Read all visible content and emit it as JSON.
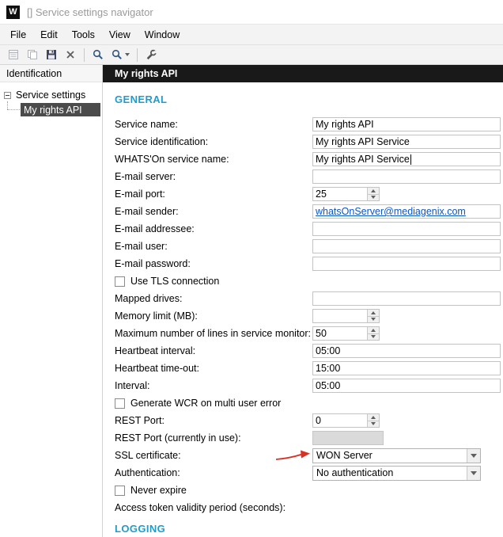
{
  "window": {
    "title": "[] Service settings navigator",
    "logo_letter": "W"
  },
  "menu": {
    "items": [
      {
        "label": "File"
      },
      {
        "label": "Edit"
      },
      {
        "label": "Tools"
      },
      {
        "label": "View"
      },
      {
        "label": "Window"
      }
    ]
  },
  "toolbar": {
    "buttons": [
      {
        "icon": "report-icon",
        "enabled": false
      },
      {
        "icon": "copy-icon",
        "enabled": false
      },
      {
        "icon": "save-icon",
        "enabled": true
      },
      {
        "icon": "delete-icon",
        "enabled": true
      },
      {
        "icon": "search-icon",
        "enabled": true
      },
      {
        "icon": "search-options-icon",
        "enabled": true
      },
      {
        "icon": "wrench-icon",
        "enabled": true
      }
    ]
  },
  "sidebar": {
    "header": "Identification",
    "items": [
      {
        "label": "Service settings",
        "expanded": true,
        "selected": false
      },
      {
        "label": "My rights API",
        "selected": true
      }
    ]
  },
  "main": {
    "header": "My rights API",
    "sections": {
      "general": "GENERAL",
      "logging": "LOGGING"
    },
    "fields": [
      {
        "label": "Service name:",
        "value": "My rights API",
        "control": "text"
      },
      {
        "label": "Service identification:",
        "value": "My rights API Service",
        "control": "text"
      },
      {
        "label": "WHATS'On service name:",
        "value": "My rights API Service",
        "control": "text",
        "focused": true
      },
      {
        "label": "E-mail server:",
        "value": "",
        "control": "text"
      },
      {
        "label": "E-mail port:",
        "value": "25",
        "control": "spinner"
      },
      {
        "label": "E-mail sender:",
        "value": "whatsOnServer@mediagenix.com",
        "control": "link"
      },
      {
        "label": "E-mail addressee:",
        "value": "",
        "control": "text"
      },
      {
        "label": "E-mail user:",
        "value": "",
        "control": "text"
      },
      {
        "label": "E-mail password:",
        "value": "",
        "control": "text"
      },
      {
        "label": "Use TLS connection",
        "control": "checkbox",
        "checked": false
      },
      {
        "label": "Mapped drives:",
        "value": "",
        "control": "text"
      },
      {
        "label": "Memory limit (MB):",
        "value": "",
        "control": "spinner"
      },
      {
        "label": "Maximum number of lines in service monitor:",
        "value": "50",
        "control": "spinner"
      },
      {
        "label": "Heartbeat interval:",
        "value": "05:00",
        "control": "small"
      },
      {
        "label": "Heartbeat time-out:",
        "value": "15:00",
        "control": "small"
      },
      {
        "label": "Interval:",
        "value": "05:00",
        "control": "small"
      },
      {
        "label": "Generate WCR on multi user error",
        "control": "checkbox",
        "checked": false
      },
      {
        "label": "REST Port:",
        "value": "0",
        "control": "spinner"
      },
      {
        "label": "REST Port (currently in use):",
        "value": "",
        "control": "disabled"
      },
      {
        "label": "SSL certificate:",
        "value": "WON Server",
        "control": "dropdown",
        "annotated": true
      },
      {
        "label": "Authentication:",
        "value": "No authentication",
        "control": "dropdown"
      },
      {
        "label": "Never expire",
        "control": "checkbox",
        "checked": false
      },
      {
        "label": "Access token validity period (seconds):",
        "value": "",
        "control": "none"
      }
    ],
    "annotation": {
      "type": "red-arrow",
      "target": "SSL certificate dropdown"
    }
  },
  "colors": {
    "accent": "#1f9ccd",
    "header_bg": "#191919",
    "selection_bg": "#4b4b4b",
    "link": "#0a55c8",
    "annotation_red": "#d93025",
    "title_text": "#9a9a9a"
  }
}
